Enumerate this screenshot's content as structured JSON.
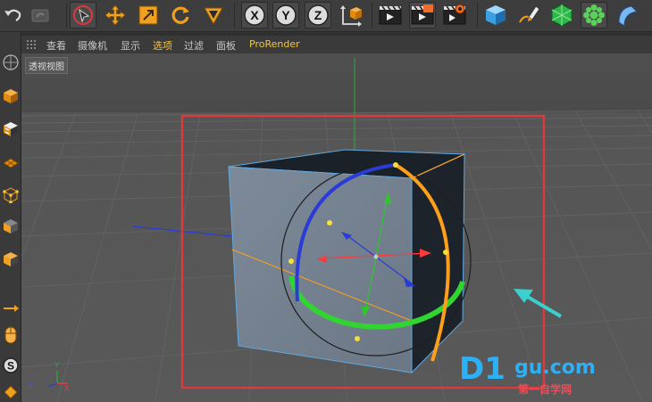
{
  "toolbar": {
    "icons": [
      "undo-icon",
      "redo-icon",
      "select-cursor-icon",
      "move-icon",
      "scale-icon",
      "rotate-icon",
      "recent-tool-icon",
      "x-axis-lock-icon",
      "y-axis-lock-icon",
      "z-axis-lock-icon",
      "coordinate-system-icon",
      "render-view-icon",
      "render-to-picture-viewer-icon",
      "render-settings-icon",
      "cube-primitive-icon",
      "pen-spline-icon",
      "subdivision-surface-icon",
      "cloner-icon",
      "deformer-icon"
    ],
    "x_label": "X",
    "y_label": "Y",
    "z_label": "Z"
  },
  "viewport_menu": {
    "items": [
      {
        "label": "查看",
        "active": false
      },
      {
        "label": "摄像机",
        "active": false
      },
      {
        "label": "显示",
        "active": false
      },
      {
        "label": "选项",
        "active": true
      },
      {
        "label": "过滤",
        "active": false
      },
      {
        "label": "面板",
        "active": false
      },
      {
        "label": "ProRender",
        "active": true
      }
    ]
  },
  "viewport": {
    "view_name": "透视视图",
    "axis_y": "Y",
    "axis_x": "X",
    "axis_z": "Z"
  },
  "left_tools": [
    "camera-tool-icon",
    "model-mode-icon",
    "texture-mode-icon",
    "workplane-icon",
    "points-mode-icon",
    "edges-mode-icon",
    "polygons-mode-icon",
    "axis-mode-icon",
    "mouse-tool-icon",
    "snap-icon",
    "quantize-icon"
  ],
  "watermark": {
    "logo": "D1",
    "domain": "gu.com",
    "tagline": "第一自学网"
  },
  "colors": {
    "selection_box": "#e0393d",
    "arrow": "#3ad0cf",
    "rotation_x": "#ff9f1a",
    "rotation_y": "#31d431",
    "rotation_z": "#2b3bd6",
    "highlight": "#f4c341",
    "watermark": "#2fb0f4"
  }
}
